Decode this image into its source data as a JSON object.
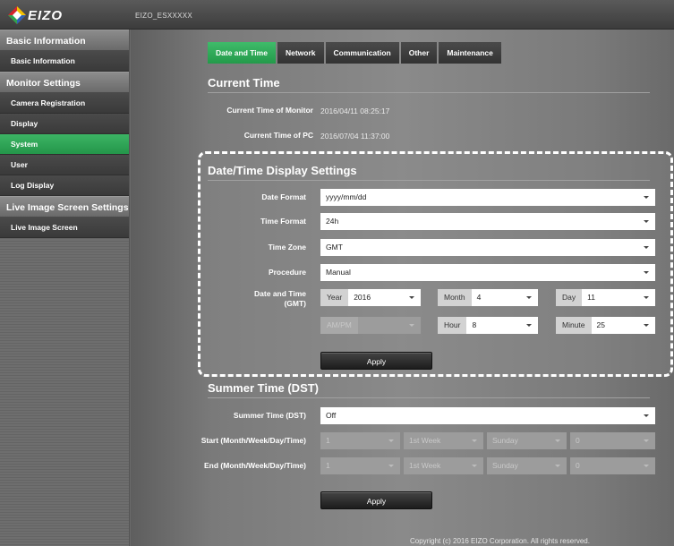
{
  "app": {
    "logo": "EIZO",
    "device_name": "EIZO_ESXXXXX"
  },
  "sidebar": {
    "sections": [
      {
        "title": "Basic Information",
        "items": [
          {
            "label": "Basic Information",
            "active": false
          }
        ]
      },
      {
        "title": "Monitor Settings",
        "items": [
          {
            "label": "Camera Registration",
            "active": false
          },
          {
            "label": "Display",
            "active": false
          },
          {
            "label": "System",
            "active": true
          },
          {
            "label": "User",
            "active": false
          },
          {
            "label": "Log Display",
            "active": false
          }
        ]
      },
      {
        "title": "Live Image Screen Settings",
        "items": [
          {
            "label": "Live Image Screen",
            "active": false
          }
        ]
      }
    ]
  },
  "tabs": [
    {
      "label": "Date and Time",
      "active": true
    },
    {
      "label": "Network",
      "active": false
    },
    {
      "label": "Communication",
      "active": false
    },
    {
      "label": "Other",
      "active": false
    },
    {
      "label": "Maintenance",
      "active": false
    }
  ],
  "current_time": {
    "title": "Current Time",
    "monitor_label": "Current Time of Monitor",
    "monitor_value": "2016/04/11 08:25:17",
    "pc_label": "Current Time of PC",
    "pc_value": "2016/07/04 11:37:00"
  },
  "display_settings": {
    "title": "Date/Time Display Settings",
    "date_format_label": "Date Format",
    "date_format_value": "yyyy/mm/dd",
    "time_format_label": "Time Format",
    "time_format_value": "24h",
    "time_zone_label": "Time Zone",
    "time_zone_value": "GMT",
    "procedure_label": "Procedure",
    "procedure_value": "Manual",
    "date_time_label_line1": "Date and Time",
    "date_time_label_line2": "(GMT)",
    "year_caption": "Year",
    "year_value": "2016",
    "month_caption": "Month",
    "month_value": "4",
    "day_caption": "Day",
    "day_value": "11",
    "ampm_caption": "AM/PM",
    "ampm_value": "",
    "hour_caption": "Hour",
    "hour_value": "8",
    "minute_caption": "Minute",
    "minute_value": "25",
    "apply_label": "Apply"
  },
  "summer_time": {
    "title": "Summer Time (DST)",
    "dst_label": "Summer Time (DST)",
    "dst_value": "Off",
    "start_label": "Start (Month/Week/Day/Time)",
    "end_label": "End (Month/Week/Day/Time)",
    "start_values": [
      "1",
      "1st Week",
      "Sunday",
      "0"
    ],
    "end_values": [
      "1",
      "1st Week",
      "Sunday",
      "0"
    ],
    "apply_label": "Apply"
  },
  "footer": {
    "copyright": "Copyright (c) 2016 EIZO Corporation. All rights reserved."
  },
  "colors": {
    "accent_green": "#2aa855",
    "dashed_highlight": "#ffffff"
  }
}
